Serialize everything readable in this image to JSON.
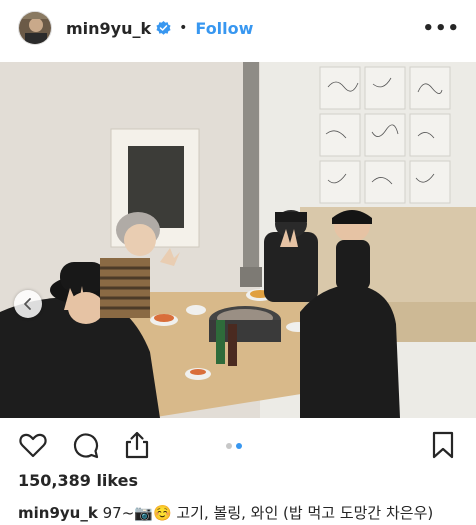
{
  "header": {
    "username": "min9yu_k",
    "separator": "•",
    "follow_label": "Follow",
    "more_label": "•••"
  },
  "carousel": {
    "total": 2,
    "active_index": 1
  },
  "post": {
    "likes": "150,389 likes",
    "caption_user": "min9yu_k",
    "caption_text": "97~📷☺️ 고기, 볼링, 와인 (밥 먹고 도망간 차은우)"
  },
  "icons": [
    "verified-badge-icon",
    "more-options-icon",
    "chevron-left-icon",
    "heart-icon",
    "comment-icon",
    "share-icon",
    "bookmark-icon"
  ],
  "colors": {
    "accent": "#3897f0",
    "text": "#262626",
    "dot_inactive": "#c7c7c7"
  }
}
